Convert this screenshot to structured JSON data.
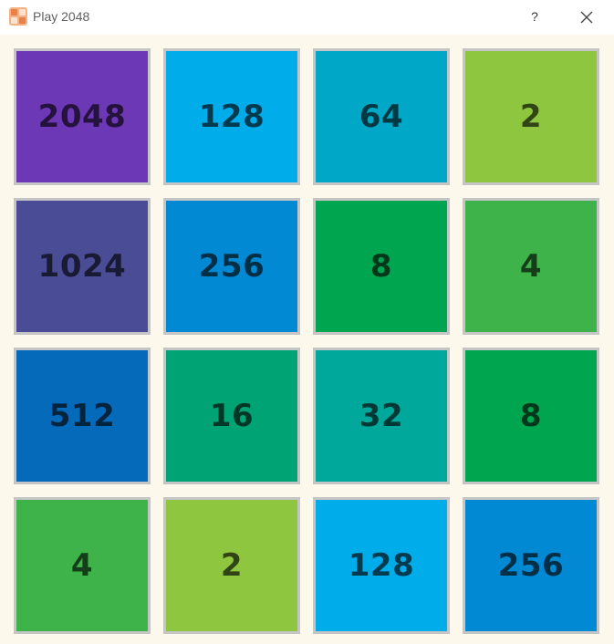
{
  "window": {
    "title": "Play 2048",
    "help_label": "?",
    "app_icon": "2048-app-icon",
    "close_icon": "close-icon"
  },
  "board": {
    "rows": [
      [
        {
          "value": "2048",
          "color": "#6d38b6"
        },
        {
          "value": "128",
          "color": "#00acea"
        },
        {
          "value": "64",
          "color": "#00a7c6"
        },
        {
          "value": "2",
          "color": "#8ec63f"
        }
      ],
      [
        {
          "value": "1024",
          "color": "#4b4c96"
        },
        {
          "value": "256",
          "color": "#0289d4"
        },
        {
          "value": "8",
          "color": "#00a550"
        },
        {
          "value": "4",
          "color": "#3eb34a"
        }
      ],
      [
        {
          "value": "512",
          "color": "#056ab9"
        },
        {
          "value": "16",
          "color": "#00a474"
        },
        {
          "value": "32",
          "color": "#00a89b"
        },
        {
          "value": "8",
          "color": "#00a550"
        }
      ],
      [
        {
          "value": "4",
          "color": "#3eb34a"
        },
        {
          "value": "2",
          "color": "#8ec63f"
        },
        {
          "value": "128",
          "color": "#00acea"
        },
        {
          "value": "256",
          "color": "#0289d4"
        }
      ]
    ]
  }
}
